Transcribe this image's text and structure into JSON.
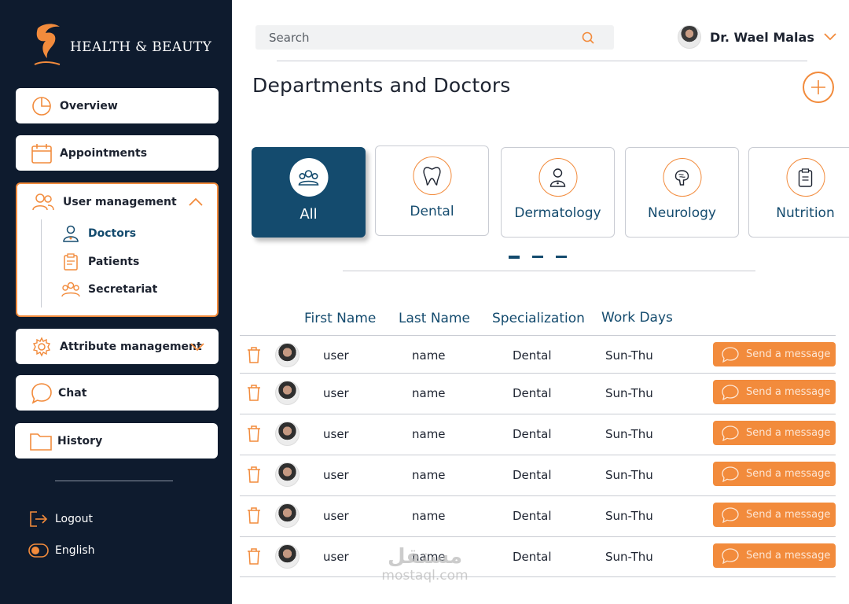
{
  "brand": {
    "name": "HEALTH & BEAUTY",
    "logo_icon": "swan-leaf-logo",
    "accent": "#f28b3c",
    "primary": "#144b6e",
    "sidebar_bg": "#0e1b2e"
  },
  "sidebar": {
    "overview": {
      "label": "Overview",
      "icon": "pie-chart-icon"
    },
    "appointments": {
      "label": "Appointments",
      "icon": "calendar-icon"
    },
    "user_management": {
      "label": "User management",
      "icon": "users-icon",
      "expanded": true,
      "items": [
        {
          "label": "Doctors",
          "icon": "doctor-icon",
          "active": true
        },
        {
          "label": "Patients",
          "icon": "clipboard-icon",
          "active": false
        },
        {
          "label": "Secretariat",
          "icon": "group-icon",
          "active": false
        }
      ]
    },
    "attribute_management": {
      "label": "Attribute management",
      "icon": "gear-icon"
    },
    "chat": {
      "label": "Chat",
      "icon": "chat-bubble-icon"
    },
    "history": {
      "label": "History",
      "icon": "folder-icon"
    },
    "logout": {
      "label": "Logout",
      "icon": "logout-icon"
    },
    "language": {
      "label": "English",
      "icon": "toggle-icon"
    }
  },
  "header": {
    "search_placeholder": "Search",
    "user_name": "Dr. Wael Malas"
  },
  "page": {
    "title": "Departments and Doctors"
  },
  "departments": [
    {
      "label": "All",
      "icon": "group-icon",
      "active": true
    },
    {
      "label": "Dental",
      "icon": "tooth-icon",
      "active": false
    },
    {
      "label": "Dermatology",
      "icon": "person-icon",
      "active": false
    },
    {
      "label": "Neurology",
      "icon": "brain-icon",
      "active": false
    },
    {
      "label": "Nutrition",
      "icon": "clipboard-icon",
      "active": false
    }
  ],
  "carousel": {
    "pages": 3,
    "current": 1
  },
  "table": {
    "headers": [
      "First Name",
      "Last Name",
      "Specialization",
      "Work Days"
    ],
    "rows": [
      {
        "first": "user",
        "last": "name",
        "spec": "Dental",
        "days": "Sun-Thu",
        "action": "Send a message"
      },
      {
        "first": "user",
        "last": "name",
        "spec": "Dental",
        "days": "Sun-Thu",
        "action": "Send a message"
      },
      {
        "first": "user",
        "last": "name",
        "spec": "Dental",
        "days": "Sun-Thu",
        "action": "Send a message"
      },
      {
        "first": "user",
        "last": "name",
        "spec": "Dental",
        "days": "Sun-Thu",
        "action": "Send a message"
      },
      {
        "first": "user",
        "last": "name",
        "spec": "Dental",
        "days": "Sun-Thu",
        "action": "Send a message"
      },
      {
        "first": "user",
        "last": "name",
        "spec": "Dental",
        "days": "Sun-Thu",
        "action": "Send a message"
      }
    ]
  },
  "watermark": {
    "arabic": "مستقل",
    "latin": "mostaql.com"
  }
}
